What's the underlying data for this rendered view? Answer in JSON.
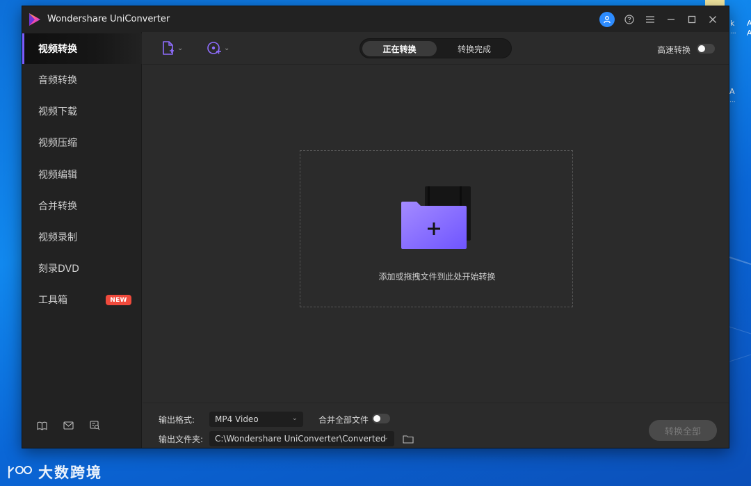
{
  "desktop": {
    "edge_text": [
      "k",
      "A",
      "...",
      "A",
      "A",
      "..."
    ],
    "watermark_text": "大数跨境"
  },
  "app": {
    "title": "Wondershare UniConverter",
    "accent": "#7a5cff",
    "window_controls": [
      "account-icon",
      "help-icon",
      "menu-icon",
      "minimize-icon",
      "maximize-icon",
      "close-icon"
    ]
  },
  "sidebar": {
    "items": [
      {
        "label": "视频转换",
        "active": true
      },
      {
        "label": "音频转换",
        "active": false
      },
      {
        "label": "视频下载",
        "active": false
      },
      {
        "label": "视频压缩",
        "active": false
      },
      {
        "label": "视频编辑",
        "active": false
      },
      {
        "label": "合并转换",
        "active": false
      },
      {
        "label": "视频录制",
        "active": false
      },
      {
        "label": "刻录DVD",
        "active": false
      },
      {
        "label": "工具箱",
        "active": false,
        "badge": "NEW"
      }
    ],
    "footer_icons": [
      "book-icon",
      "mail-icon",
      "feedback-icon"
    ]
  },
  "toolbar": {
    "add_file_icon": "add-file-icon",
    "add_media_icon": "add-dvd-icon",
    "tabs": [
      {
        "label": "正在转换",
        "selected": true
      },
      {
        "label": "转换完成",
        "selected": false
      }
    ],
    "high_speed_label": "高速转换",
    "high_speed_on": false
  },
  "dropzone": {
    "hint": "添加或拖拽文件到此处开始转换"
  },
  "bottom": {
    "output_format_label": "输出格式:",
    "output_format_value": "MP4 Video",
    "merge_label": "合并全部文件",
    "merge_on": false,
    "output_folder_label": "输出文件夹:",
    "output_folder_value": "C:\\Wondershare UniConverter\\Converted",
    "convert_all_label": "转换全部"
  }
}
